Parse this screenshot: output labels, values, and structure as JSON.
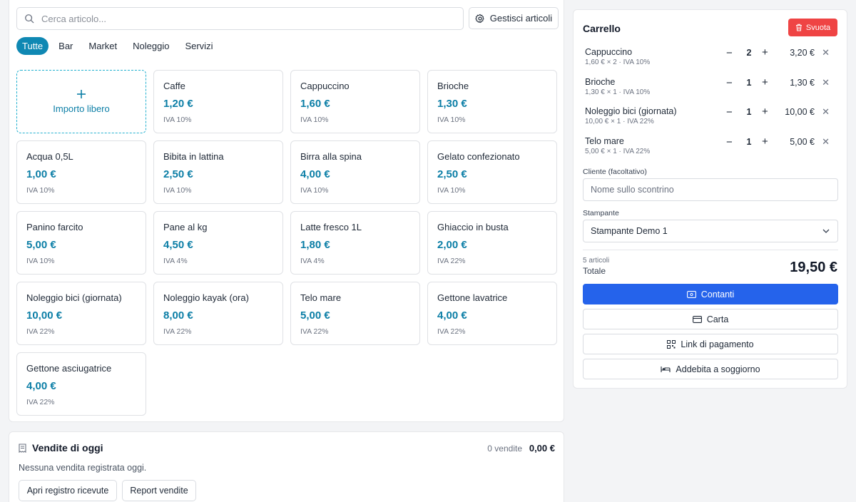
{
  "search": {
    "placeholder": "Cerca articolo..."
  },
  "toolbar": {
    "manage_label": "Gestisci articoli"
  },
  "categories": [
    "Tutte",
    "Bar",
    "Market",
    "Noleggio",
    "Servizi"
  ],
  "free_amount": {
    "label": "Importo libero"
  },
  "products": [
    {
      "name": "Caffe",
      "price": "1,20 €",
      "vat": "IVA 10%"
    },
    {
      "name": "Cappuccino",
      "price": "1,60 €",
      "vat": "IVA 10%"
    },
    {
      "name": "Brioche",
      "price": "1,30 €",
      "vat": "IVA 10%"
    },
    {
      "name": "Acqua 0,5L",
      "price": "1,00 €",
      "vat": "IVA 10%"
    },
    {
      "name": "Bibita in lattina",
      "price": "2,50 €",
      "vat": "IVA 10%"
    },
    {
      "name": "Birra alla spina",
      "price": "4,00 €",
      "vat": "IVA 10%"
    },
    {
      "name": "Gelato confezionato",
      "price": "2,50 €",
      "vat": "IVA 10%"
    },
    {
      "name": "Panino farcito",
      "price": "5,00 €",
      "vat": "IVA 10%"
    },
    {
      "name": "Pane al kg",
      "price": "4,50 €",
      "vat": "IVA 4%"
    },
    {
      "name": "Latte fresco 1L",
      "price": "1,80 €",
      "vat": "IVA 4%"
    },
    {
      "name": "Ghiaccio in busta",
      "price": "2,00 €",
      "vat": "IVA 22%"
    },
    {
      "name": "Noleggio bici (giornata)",
      "price": "10,00 €",
      "vat": "IVA 22%"
    },
    {
      "name": "Noleggio kayak (ora)",
      "price": "8,00 €",
      "vat": "IVA 22%"
    },
    {
      "name": "Telo mare",
      "price": "5,00 €",
      "vat": "IVA 22%"
    },
    {
      "name": "Gettone lavatrice",
      "price": "4,00 €",
      "vat": "IVA 22%"
    },
    {
      "name": "Gettone asciugatrice",
      "price": "4,00 €",
      "vat": "IVA 22%"
    }
  ],
  "sales": {
    "title": "Vendite di oggi",
    "count": "0 vendite",
    "total": "0,00 €",
    "empty": "Nessuna vendita registrata oggi.",
    "register_button": "Apri registro ricevute",
    "report_button": "Report vendite"
  },
  "cart": {
    "title": "Carrello",
    "clear_label": "Svuota",
    "items": [
      {
        "name": "Cappuccino",
        "detail": "1,60 € × 2 · IVA 10%",
        "qty": "2",
        "total": "3,20 €"
      },
      {
        "name": "Brioche",
        "detail": "1,30 € × 1 · IVA 10%",
        "qty": "1",
        "total": "1,30 €"
      },
      {
        "name": "Noleggio bici (giornata)",
        "detail": "10,00 € × 1 · IVA 22%",
        "qty": "1",
        "total": "10,00 €"
      },
      {
        "name": "Telo mare",
        "detail": "5,00 € × 1 · IVA 22%",
        "qty": "1",
        "total": "5,00 €"
      }
    ],
    "customer_label": "Cliente (facoltativo)",
    "customer_placeholder": "Nome sullo scontrino",
    "printer_label": "Stampante",
    "printer_value": "Stampante Demo 1",
    "items_count": "5 articoli",
    "total_label": "Totale",
    "total_value": "19,50 €",
    "payments": {
      "cash": "Contanti",
      "card": "Carta",
      "link": "Link di pagamento",
      "room": "Addebita a soggiorno"
    }
  },
  "colors": {
    "accent": "#0f88b3",
    "price": "#0b7ea6",
    "primary": "#2563eb",
    "danger": "#ef4444"
  },
  "icons": [
    "search-icon",
    "gear-icon",
    "plus-icon",
    "receipt-icon",
    "trash-icon",
    "minus-icon",
    "close-icon",
    "chevron-down-icon",
    "cash-icon",
    "card-icon",
    "qr-icon",
    "bed-icon"
  ]
}
